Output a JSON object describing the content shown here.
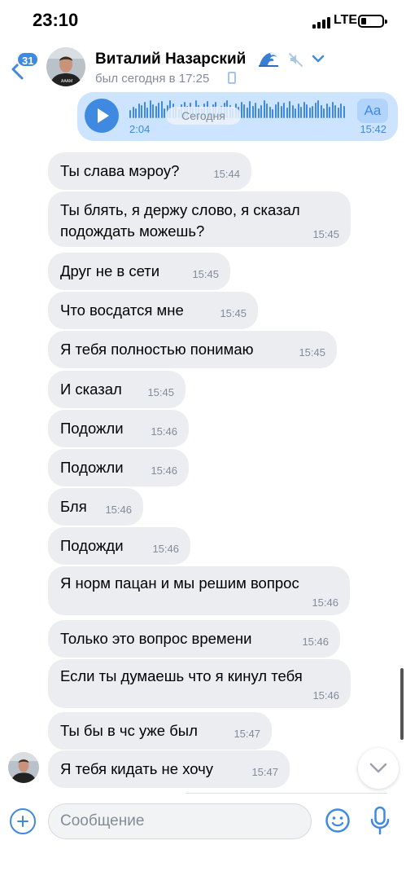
{
  "status_bar": {
    "time": "23:10",
    "network": "LTE"
  },
  "header": {
    "unread_count": "31",
    "contact_name": "Виталий Назарский",
    "contact_status": "был сегодня в 17:25"
  },
  "voice_message": {
    "duration": "2:04",
    "time": "15:42",
    "transcribe_label": "Aa"
  },
  "date_separator": "Сегодня",
  "messages": [
    {
      "text": "Ты слава мэроу?",
      "time": "15:44"
    },
    {
      "text": "Ты блять, я держу слово, я сказал подождать можешь?",
      "line1": "Ты блять, я держу слово, я сказал",
      "line2": "подождать можешь?",
      "time": "15:45"
    },
    {
      "text": "Друг не в сети",
      "time": "15:45"
    },
    {
      "text": "Что восдатся мне",
      "time": "15:45"
    },
    {
      "text": "Я тебя полностью понимаю",
      "time": "15:45"
    },
    {
      "text": "И сказал",
      "time": "15:45"
    },
    {
      "text": "Подожли",
      "time": "15:46"
    },
    {
      "text": "Подожли",
      "time": "15:46"
    },
    {
      "text": "Бля",
      "time": "15:46"
    },
    {
      "text": "Подожди",
      "time": "15:46"
    },
    {
      "text": "Я норм пацан и мы решим вопрос",
      "time": "15:46"
    },
    {
      "text": "Только это вопрос времени",
      "time": "15:46"
    },
    {
      "text": "Если ты думаешь что я кинул тебя",
      "time": "15:46"
    },
    {
      "text": "Ты бы в чс уже был",
      "time": "15:47"
    },
    {
      "text": "Я тебя кидать не хочу",
      "time": "15:47"
    }
  ],
  "composer": {
    "placeholder": "Сообщение"
  },
  "icons": {
    "back": "chevron-left-icon",
    "wave": "wave-emoji-icon",
    "mute": "muted-speaker-icon",
    "dropdown": "chevron-down-icon",
    "attach": "plus-circle-icon",
    "emoji": "smile-icon",
    "mic": "microphone-icon",
    "scroll_down": "chevron-down-icon"
  },
  "colors": {
    "accent": "#3f8ae0",
    "outgoing_bubble": "#cce4ff",
    "incoming_bubble": "#ebedf0",
    "secondary_text": "#818c99"
  }
}
